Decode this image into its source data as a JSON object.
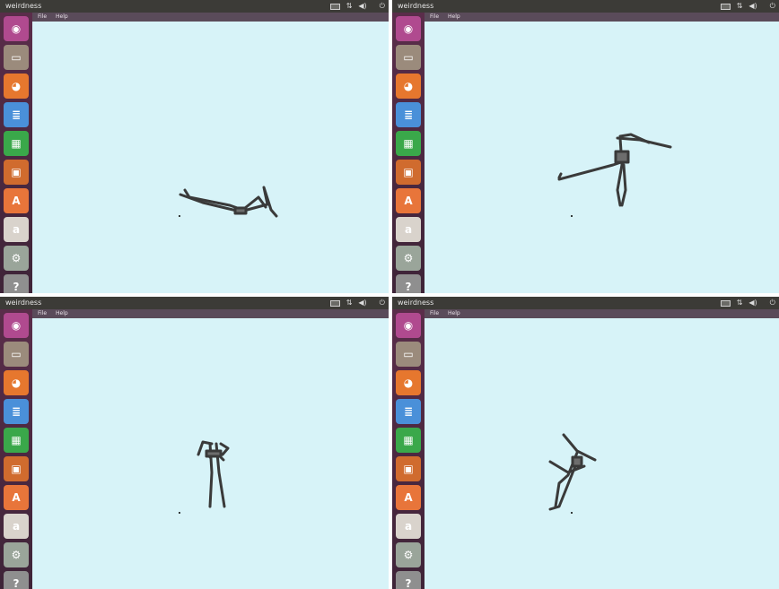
{
  "screens": [
    {
      "title": "weirdness",
      "menu": [
        "File",
        "Help"
      ],
      "indicators": {
        "keyboard": "",
        "network": "⇅",
        "sound": "◀)",
        "time": "",
        "power": "⏻"
      }
    },
    {
      "title": "weirdness",
      "menu": [
        "File",
        "Help"
      ],
      "indicators": {
        "keyboard": "",
        "network": "⇅",
        "sound": "◀)",
        "time": "",
        "power": "⏻"
      }
    },
    {
      "title": "weirdness",
      "menu": [
        "File",
        "Help"
      ],
      "indicators": {
        "keyboard": "",
        "network": "⇅",
        "sound": "◀)",
        "time": "",
        "power": "⏻"
      }
    },
    {
      "title": "weirdness",
      "menu": [
        "File",
        "Help"
      ],
      "indicators": {
        "keyboard": "",
        "network": "⇅",
        "sound": "◀)",
        "time": "",
        "power": "⏻"
      }
    }
  ],
  "launcher_icons": [
    {
      "name": "dash-icon",
      "color": "#b04a8f",
      "glyph": "◉"
    },
    {
      "name": "files-icon",
      "color": "#9b8b7c",
      "glyph": "▭"
    },
    {
      "name": "firefox-icon",
      "color": "#e6772e",
      "glyph": "◕"
    },
    {
      "name": "writer-icon",
      "color": "#4a90d9",
      "glyph": "≣"
    },
    {
      "name": "calc-icon",
      "color": "#3aa84a",
      "glyph": "▦"
    },
    {
      "name": "impress-icon",
      "color": "#d06b2e",
      "glyph": "▣"
    },
    {
      "name": "software-center-icon",
      "color": "#e8753a",
      "glyph": "A"
    },
    {
      "name": "amazon-icon",
      "color": "#d9d3cc",
      "glyph": "a"
    },
    {
      "name": "settings-icon",
      "color": "#9aa59a",
      "glyph": "⚙"
    },
    {
      "name": "trash-icon",
      "color": "#8f8f8f",
      "glyph": "?"
    }
  ],
  "colors": {
    "background": "#d7f3f8",
    "topbar": "#3c3b37",
    "launcher": "#5a2d4a",
    "stick": "#3a3a3a"
  }
}
